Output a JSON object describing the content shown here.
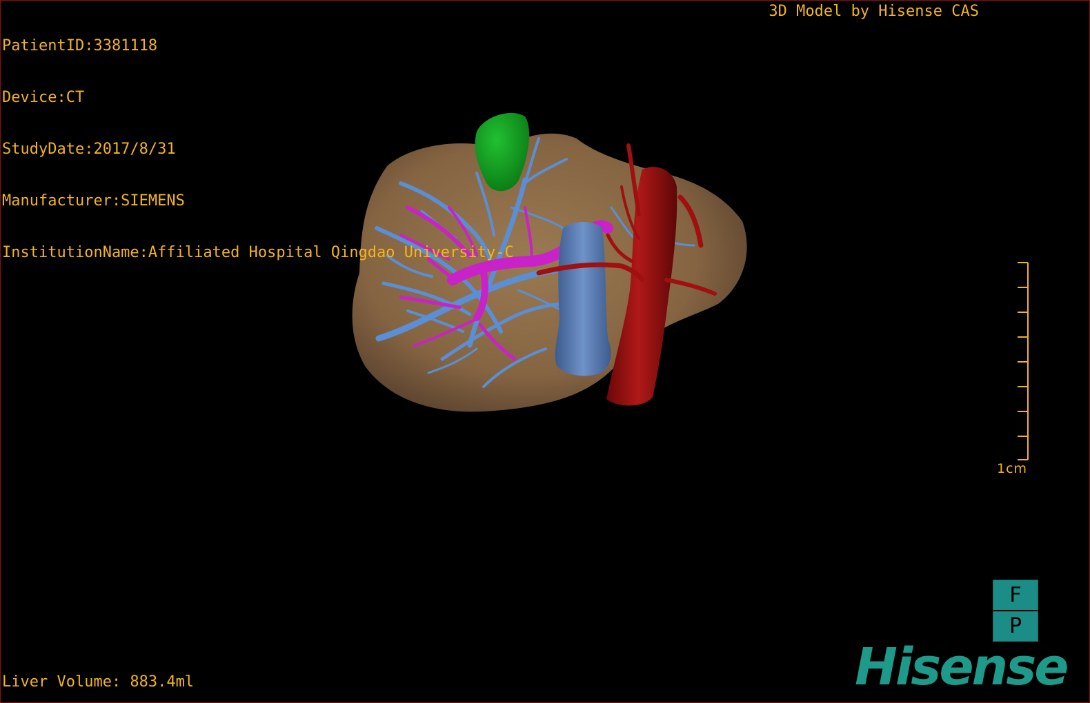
{
  "header": {
    "patient_id": "PatientID:3381118",
    "device": "Device:CT",
    "study_date": "StudyDate:2017/8/31",
    "manufacturer": "Manufacturer:SIEMENS",
    "institution": "InstitutionName:Affiliated Hospital Qingdao University-C",
    "credit": "3D Model by Hisense CAS"
  },
  "footer": {
    "liver_volume": "Liver Volume: 883.4ml"
  },
  "scale": {
    "label": "1cm"
  },
  "orientation": {
    "top_face": "F",
    "bottom_face": "P"
  },
  "brand": {
    "name": "Hisense"
  },
  "colors": {
    "overlay_text": "#f5b518",
    "liver": "#8b6a44",
    "gallbladder": "#10a020",
    "portal_vein": "#c822c8",
    "hepatic_vein": "#5a8fd6",
    "vena_cava": "#5577aa",
    "artery": "#a01010",
    "brand": "#1d9a8a"
  },
  "scene_objects": [
    {
      "name": "liver",
      "icon": "liver-model"
    },
    {
      "name": "gallbladder",
      "icon": "gallbladder-model"
    },
    {
      "name": "hepatic-veins",
      "icon": "hepatic-vein-model"
    },
    {
      "name": "portal-vein",
      "icon": "portal-vein-model"
    },
    {
      "name": "inferior-vena-cava",
      "icon": "vena-cava-model"
    },
    {
      "name": "aorta",
      "icon": "artery-model"
    }
  ]
}
